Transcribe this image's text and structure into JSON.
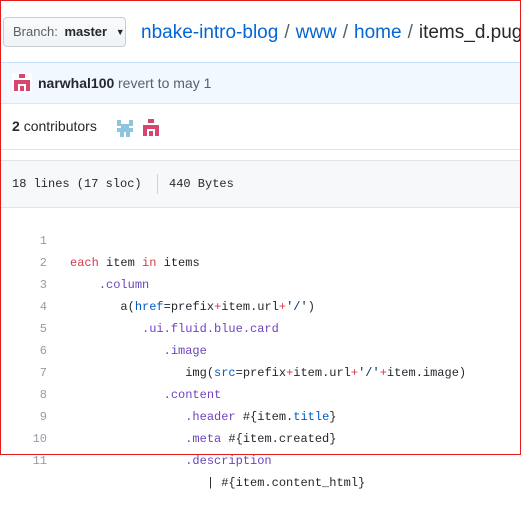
{
  "branch": {
    "label": "Branch:",
    "value": "master"
  },
  "breadcrumb": {
    "repo": "nbake-intro-blog",
    "dir1": "www",
    "dir2": "home",
    "file": "items_d.pug",
    "separator": "/"
  },
  "commit": {
    "author": "narwhal100",
    "message": "revert to may 1"
  },
  "contributors": {
    "count": "2",
    "label": "contributors"
  },
  "file_info": {
    "lines": "18 lines (17 sloc)",
    "size": "440 Bytes"
  },
  "code": {
    "line_numbers": [
      "1",
      "2",
      "3",
      "4",
      "5",
      "6",
      "7",
      "8",
      "9",
      "10",
      "11"
    ],
    "lines": {
      "l1": {
        "kw_each": "each",
        "item": " item ",
        "kw_in": "in",
        "items": " items"
      },
      "l2": {
        "column": ".column"
      },
      "l3": {
        "a_open": "a(",
        "href": "href",
        "eq_prefix": "=prefix",
        "plus1": "+",
        "item_url": "item.url",
        "plus2": "+",
        "slash": "'/'",
        "close": ")"
      },
      "l4": {
        "card": ".ui.fluid.blue.card"
      },
      "l5": {
        "image": ".image"
      },
      "l6": {
        "img_open": "img(",
        "src": "src",
        "eq_prefix": "=prefix",
        "plus1": "+",
        "item_url": "item.url",
        "plus2": "+",
        "slash": "'/'",
        "plus3": "+",
        "item_image": "item.image",
        "close": ")"
      },
      "l7": {
        "content": ".content"
      },
      "l8": {
        "header": ".header",
        "interp_open": " #{",
        "item": "item.",
        "title": "title",
        "interp_close": "}"
      },
      "l9": {
        "meta": ".meta",
        "interp": " #{item.created}"
      },
      "l10": {
        "description": ".description"
      },
      "l11": {
        "pipe": "| ",
        "interp": "#{item.content_html}"
      }
    }
  },
  "colors": {
    "frame": "#e31b1b",
    "link": "#0366d6",
    "keyword": "#d73a49",
    "class": "#6f42c1",
    "attr": "#005cc5"
  }
}
